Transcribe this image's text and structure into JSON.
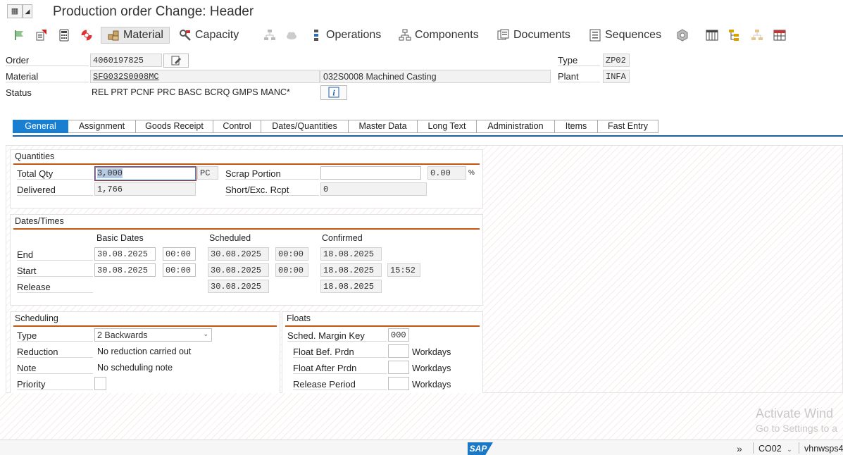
{
  "window": {
    "title": "Production order Change: Header"
  },
  "toolbar": {
    "material": "Material",
    "capacity": "Capacity",
    "operations": "Operations",
    "components": "Components",
    "documents": "Documents",
    "sequences": "Sequences"
  },
  "header": {
    "order_label": "Order",
    "order_value": "4060197825",
    "material_label": "Material",
    "material_value": "SFG032S0008MC",
    "material_desc": "032S0008 Machined Casting",
    "status_label": "Status",
    "status_value": "REL  PRT  PCNF PRC  BASC BCRQ GMPS MANC*",
    "type_label": "Type",
    "type_value": "ZP02",
    "plant_label": "Plant",
    "plant_value": "INFA"
  },
  "tabs": [
    "General",
    "Assignment",
    "Goods Receipt",
    "Control",
    "Dates/Quantities",
    "Master Data",
    "Long Text",
    "Administration",
    "Items",
    "Fast Entry"
  ],
  "quantities": {
    "title": "Quantities",
    "total_qty_label": "Total Qty",
    "total_qty": "3,000",
    "unit": "PC",
    "delivered_label": "Delivered",
    "delivered": "1,766",
    "scrap_label": "Scrap Portion",
    "scrap_value": "",
    "scrap_pct": "0.00",
    "pct_sign": "%",
    "short_label": "Short/Exc. Rcpt",
    "short_value": "0"
  },
  "dates": {
    "title": "Dates/Times",
    "col_basic": "Basic Dates",
    "col_scheduled": "Scheduled",
    "col_confirmed": "Confirmed",
    "end_label": "End",
    "start_label": "Start",
    "release_label": "Release",
    "end_basic_date": "30.08.2025",
    "end_basic_time": "00:00",
    "end_sched_date": "30.08.2025",
    "end_sched_time": "00:00",
    "end_conf_date": "18.08.2025",
    "start_basic_date": "30.08.2025",
    "start_basic_time": "00:00",
    "start_sched_date": "30.08.2025",
    "start_sched_time": "00:00",
    "start_conf_date": "18.08.2025",
    "start_conf_time": "15:52",
    "release_sched_date": "30.08.2025",
    "release_conf_date": "18.08.2025"
  },
  "scheduling": {
    "title": "Scheduling",
    "type_label": "Type",
    "type_value": "2 Backwards",
    "reduction_label": "Reduction",
    "reduction_value": "No reduction carried out",
    "note_label": "Note",
    "note_value": "No scheduling note",
    "priority_label": "Priority",
    "priority_value": ""
  },
  "floats": {
    "title": "Floats",
    "margin_label": "Sched. Margin Key",
    "margin_value": "000",
    "bef_label": "Float Bef. Prdn",
    "after_label": "Float After Prdn",
    "release_label": "Release Period",
    "workdays": "Workdays"
  },
  "watermark": {
    "line1": "Activate Wind",
    "line2": "Go to Settings to a"
  },
  "statusbar": {
    "logo": "SAP",
    "transaction": "CO02",
    "system": "vhnwsps4"
  }
}
